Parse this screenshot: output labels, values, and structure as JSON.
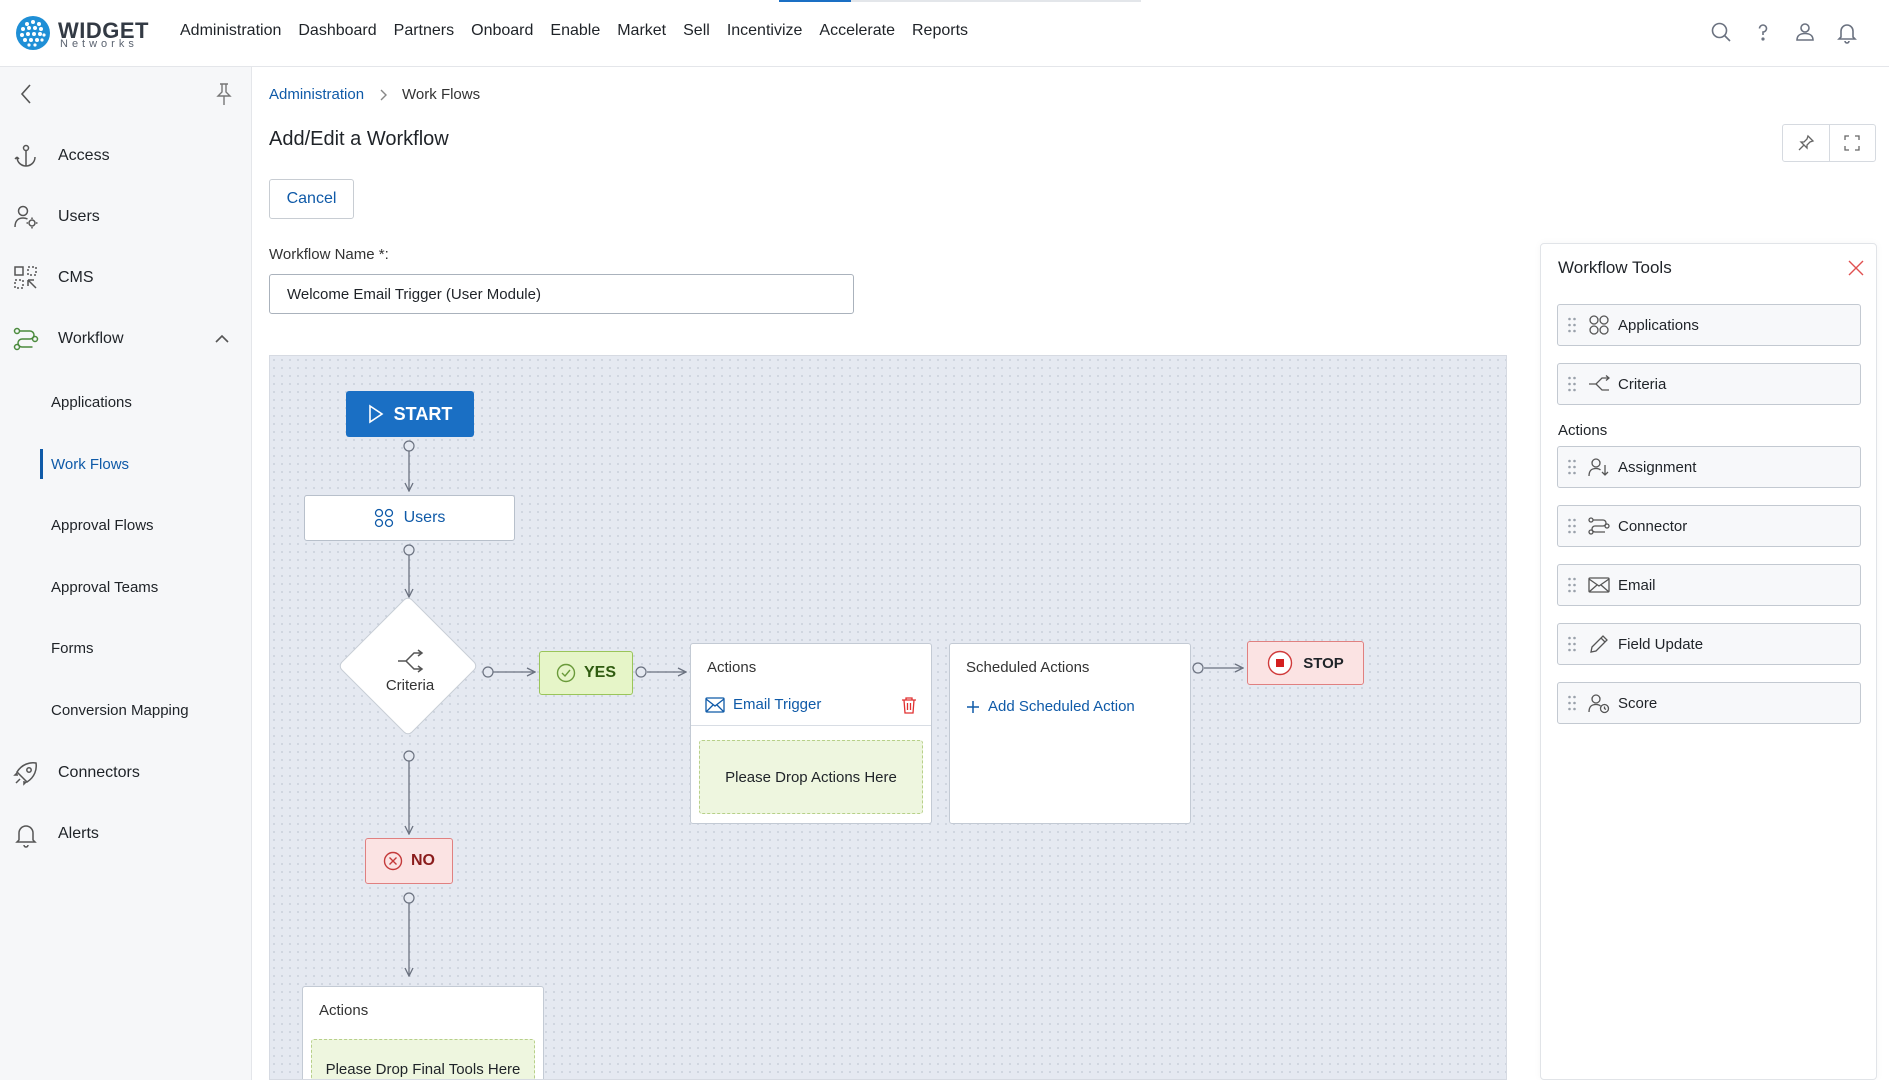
{
  "brand": {
    "name": "WIDGET",
    "sub": "Networks",
    "color": "#1f8fd6"
  },
  "nav": [
    "Administration",
    "Dashboard",
    "Partners",
    "Onboard",
    "Enable",
    "Market",
    "Sell",
    "Incentivize",
    "Accelerate",
    "Reports"
  ],
  "top_icons": [
    "search-icon",
    "help-icon",
    "user-icon",
    "bell-icon"
  ],
  "sidebar": {
    "items": [
      {
        "label": "Access",
        "icon": "anchor-icon"
      },
      {
        "label": "Users",
        "icon": "user-gear-icon"
      },
      {
        "label": "CMS",
        "icon": "cms-icon"
      },
      {
        "label": "Workflow",
        "icon": "workflow-icon",
        "expanded": true
      },
      {
        "label": "Connectors",
        "icon": "rocket-icon"
      },
      {
        "label": "Alerts",
        "icon": "bell-icon"
      }
    ],
    "sub_items": [
      "Applications",
      "Work Flows",
      "Approval Flows",
      "Approval Teams",
      "Forms",
      "Conversion Mapping"
    ],
    "active_sub": "Work Flows"
  },
  "breadcrumb": {
    "parent": "Administration",
    "current": "Work Flows"
  },
  "page": {
    "title": "Add/Edit a Workflow",
    "cancel_label": "Cancel",
    "name_label": "Workflow Name *:",
    "name_value": "Welcome Email Trigger (User Module)"
  },
  "canvas": {
    "start_label": "START",
    "users_label": "Users",
    "criteria_label": "Criteria",
    "yes_label": "YES",
    "no_label": "NO",
    "stop_label": "STOP",
    "actions_title": "Actions",
    "action_item": "Email Trigger",
    "drop_actions": "Please Drop Actions Here",
    "scheduled_title": "Scheduled Actions",
    "add_scheduled": "Add Scheduled Action",
    "final_actions_title": "Actions",
    "drop_final": "Please Drop Final Tools Here"
  },
  "tools": {
    "title": "Workflow Tools",
    "top_items": [
      {
        "label": "Applications",
        "icon": "apps-icon"
      },
      {
        "label": "Criteria",
        "icon": "branch-icon"
      }
    ],
    "section_label": "Actions",
    "action_items": [
      {
        "label": "Assignment",
        "icon": "assign-icon"
      },
      {
        "label": "Connector",
        "icon": "connector-icon"
      },
      {
        "label": "Email",
        "icon": "mail-icon"
      },
      {
        "label": "Field Update",
        "icon": "pencil-icon"
      },
      {
        "label": "Score",
        "icon": "score-icon"
      }
    ]
  },
  "colors": {
    "primary": "#1a6fc4",
    "link": "#0f5aa8",
    "yes": "#e6f5c8",
    "no": "#fbe3e3",
    "danger": "#e03030"
  }
}
